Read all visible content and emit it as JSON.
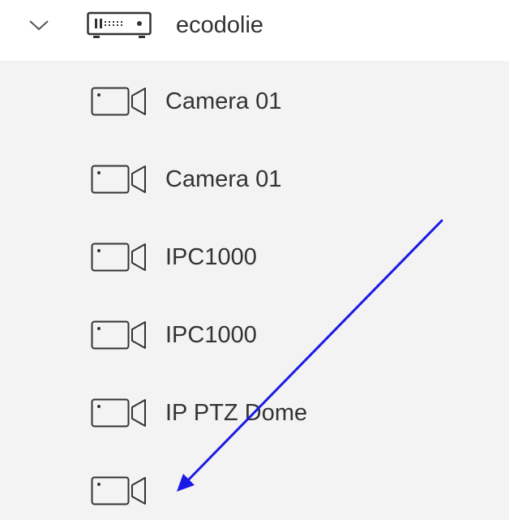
{
  "tree": {
    "group": {
      "label": "ecodolie",
      "expanded": true,
      "toggle_icon": "chevron-down-icon",
      "device_icon": "nvr-recorder-icon"
    },
    "cameras": [
      {
        "label": "Camera 01",
        "icon": "camera-icon"
      },
      {
        "label": "Camera 01",
        "icon": "camera-icon"
      },
      {
        "label": "IPC1000",
        "icon": "camera-icon"
      },
      {
        "label": "IPC1000",
        "icon": "camera-icon"
      },
      {
        "label": "IP PTZ Dome",
        "icon": "camera-icon"
      },
      {
        "label": "",
        "icon": "camera-icon"
      }
    ]
  },
  "annotation": {
    "type": "arrow",
    "color": "#1a1ae6"
  },
  "colors": {
    "list_background": "#f3f3f3",
    "text": "#333333",
    "icon_stroke": "#333333"
  }
}
